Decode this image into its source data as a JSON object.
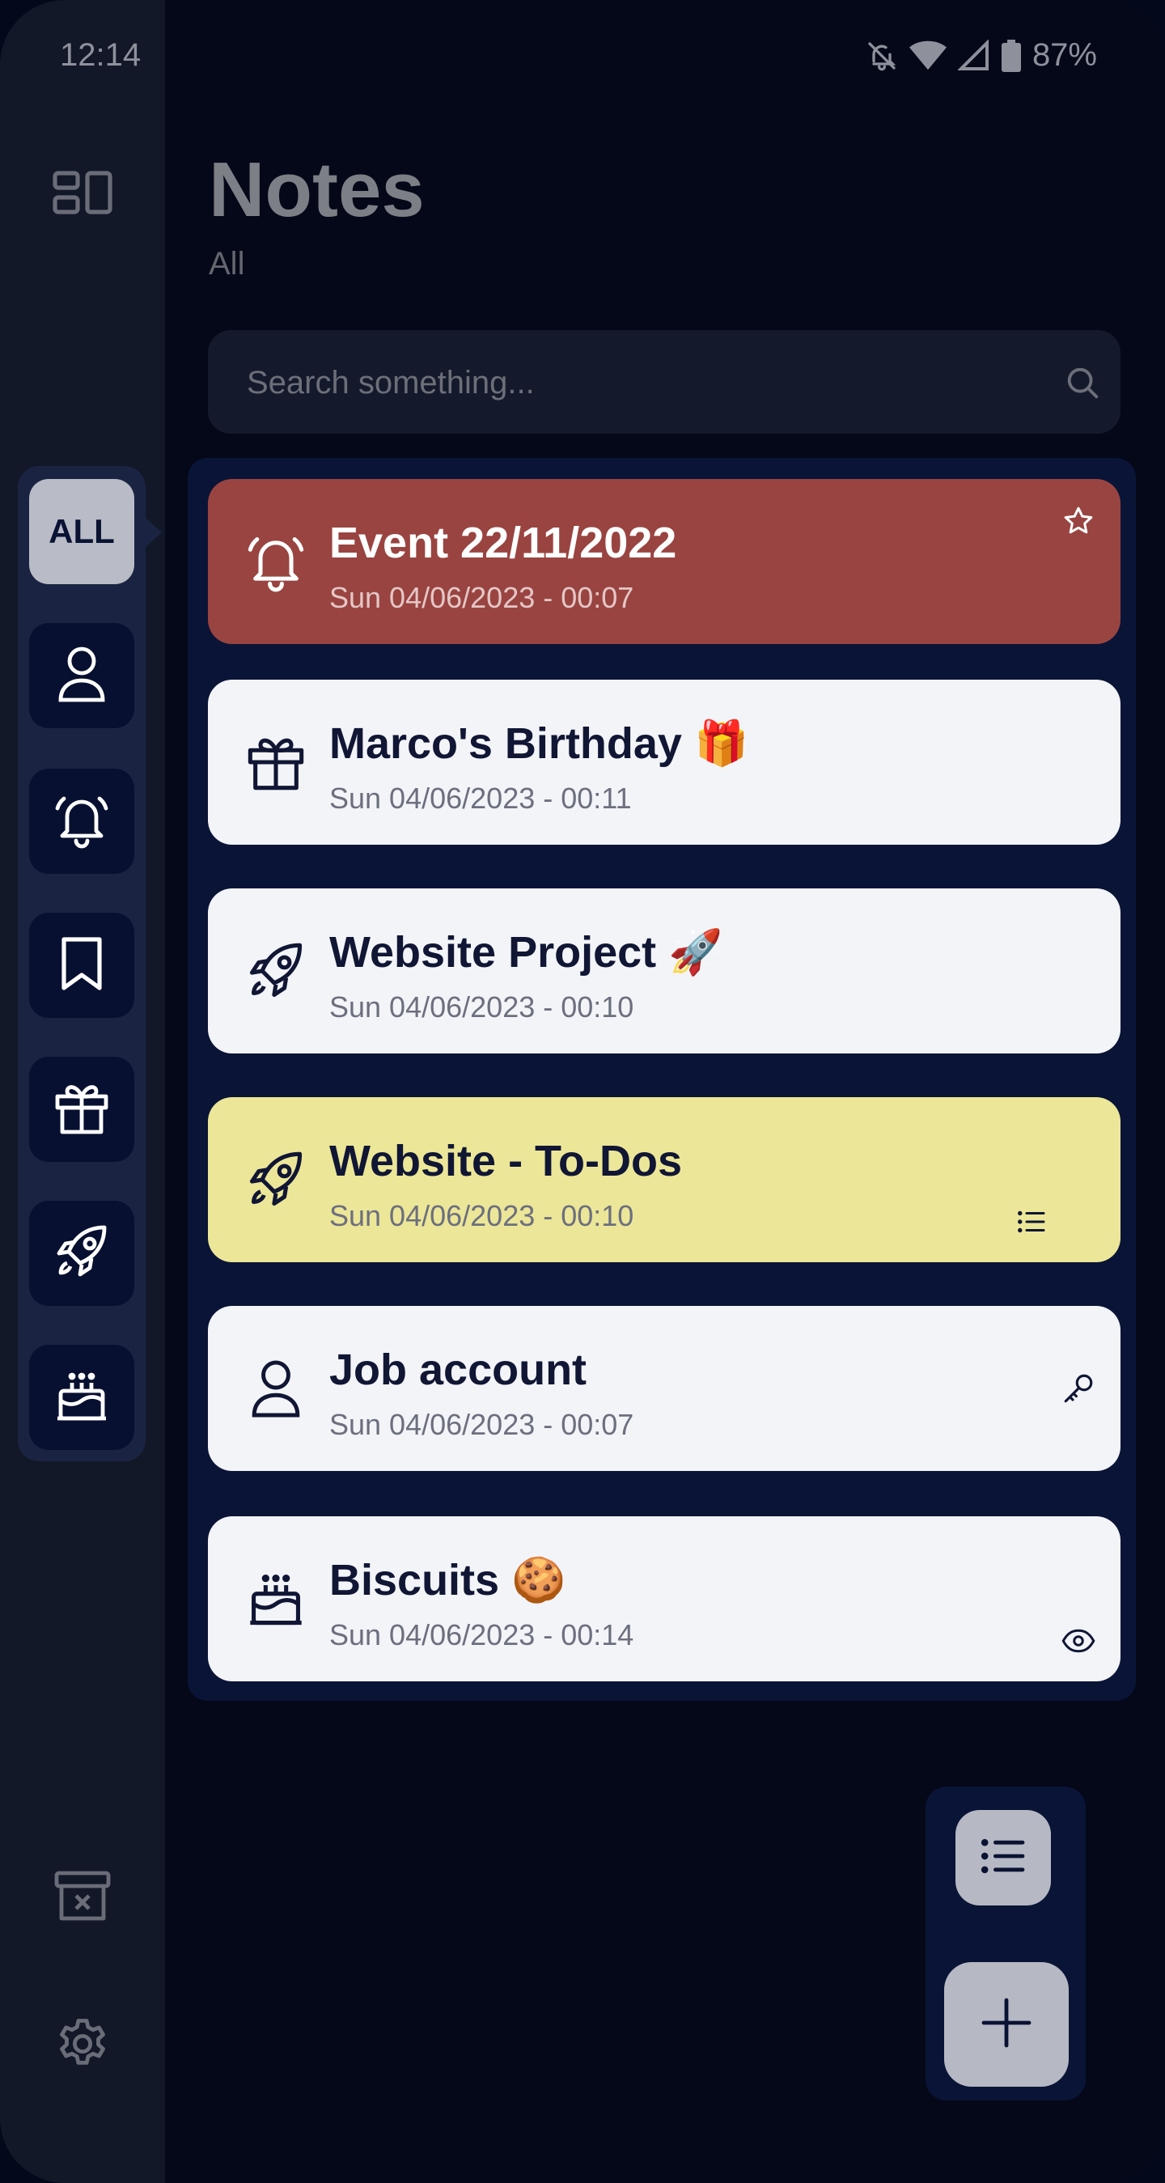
{
  "status_bar": {
    "time": "12:14",
    "battery": "87%"
  },
  "header": {
    "title": "Notes",
    "subtitle": "All"
  },
  "search": {
    "placeholder": "Search something..."
  },
  "categories": {
    "all_label": "ALL"
  },
  "notes": [
    {
      "title": "Event 22/11/2022",
      "date": "Sun 04/06/2023 - 00:07",
      "icon": "bell-icon",
      "badge": "star-icon",
      "color": "#994441"
    },
    {
      "title": "Marco's Birthday 🎁",
      "date": "Sun 04/06/2023 - 00:11",
      "icon": "gift-icon",
      "badge": "",
      "color": "#f3f4f8"
    },
    {
      "title": "Website Project 🚀",
      "date": "Sun 04/06/2023 - 00:10",
      "icon": "rocket-icon",
      "badge": "",
      "color": "#f3f4f8"
    },
    {
      "title": "Website - To-Dos",
      "date": "Sun 04/06/2023 - 00:10",
      "icon": "rocket-icon",
      "badge": "checklist-icon",
      "color": "#ece698"
    },
    {
      "title": "Job account",
      "date": "Sun 04/06/2023 - 00:07",
      "icon": "person-icon",
      "badge": "key-icon",
      "color": "#f3f4f8"
    },
    {
      "title": "Biscuits 🍪",
      "date": "Sun 04/06/2023 - 00:14",
      "icon": "cake-icon",
      "badge": "eye-icon",
      "color": "#f3f4f8"
    }
  ],
  "colors": {
    "background": "#03081a",
    "rail": "#131828",
    "accent_red": "#994441",
    "accent_yellow": "#ece698",
    "card": "#f3f4f8"
  }
}
